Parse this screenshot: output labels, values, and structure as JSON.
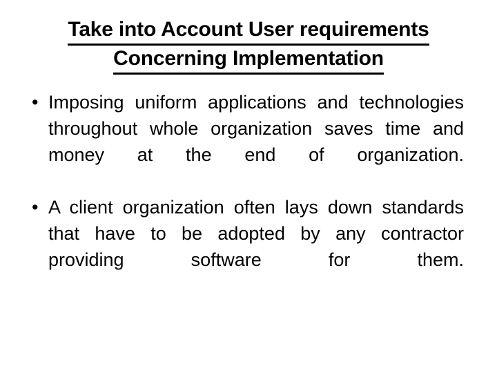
{
  "slide": {
    "background_color": "#ffffff",
    "text_color": "#000000",
    "title": {
      "line1": "Take into Account User requirements",
      "line2": "Concerning Implementation",
      "underline": true,
      "bold": true,
      "align": "center"
    },
    "bullets": [
      {
        "marker": "•",
        "text": "Imposing uniform applications and technologies throughout whole organization saves time and money at the end of organization."
      },
      {
        "marker": "•",
        "text": "A client organization often lays down standards that have to be adopted by any contractor providing software for them."
      }
    ]
  }
}
